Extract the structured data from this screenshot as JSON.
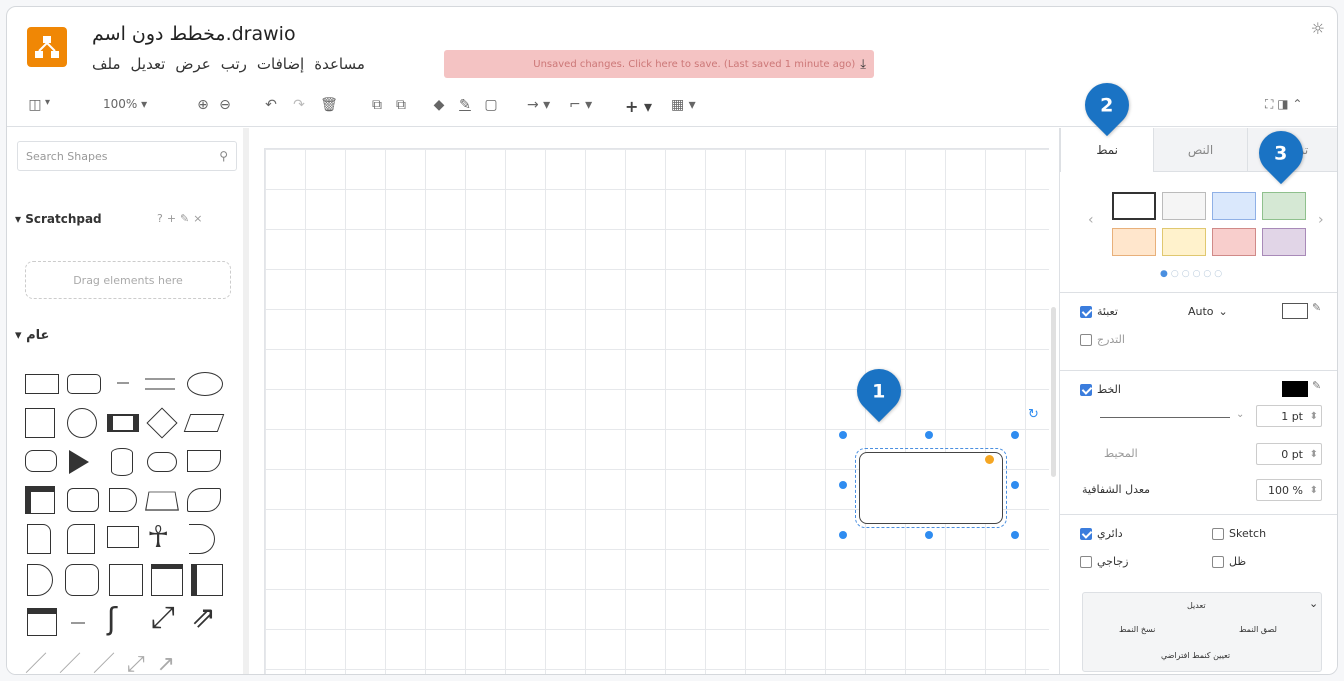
{
  "app": {
    "title": "مخطط دون اسم.drawio",
    "menu": [
      "ملف",
      "تعديل",
      "عرض",
      "رتب",
      "إضافات",
      "مساعدة"
    ],
    "unsaved_text": "Unsaved changes. Click here to save. (Last saved 1 minute ago)",
    "settings_icon": "sun-icon"
  },
  "toolbar": {
    "zoom": "100%"
  },
  "left_panel": {
    "search_placeholder": "Search Shapes",
    "scratchpad_title": "Scratchpad",
    "drag_hint": "Drag elements here",
    "general_title": "عام"
  },
  "markers": [
    "1",
    "2",
    "3"
  ],
  "right_panel": {
    "tabs": [
      "نمط",
      "النص",
      "ترتيب"
    ],
    "fill_label": "تعبئة",
    "fill_value": "Auto",
    "gradient_label": "التدرج",
    "line_label": "الخط",
    "line_width": "1 pt",
    "perimeter_label": "المحيط",
    "perimeter_value": "0 pt",
    "opacity_label": "معدل الشفافية",
    "opacity_value": "100 %",
    "rounded_label": "دائري",
    "sketch_label": "Sketch",
    "glass_label": "زجاجي",
    "shadow_label": "ظل",
    "edit_label": "تعديل",
    "copy_style": "نسخ النمط",
    "paste_style": "لصق النمط",
    "set_default": "تعيين كنمط افتراضي"
  },
  "colors": {
    "accent": "#1a73c4",
    "logo": "#f08705",
    "unsaved_bg": "#f4c3c3",
    "swatches": [
      "#ffffff",
      "#f5f5f5",
      "#dae8fc",
      "#d5e8d4",
      "#ffe6cc",
      "#fff2cc",
      "#f8cecc",
      "#e1d5e7"
    ]
  }
}
